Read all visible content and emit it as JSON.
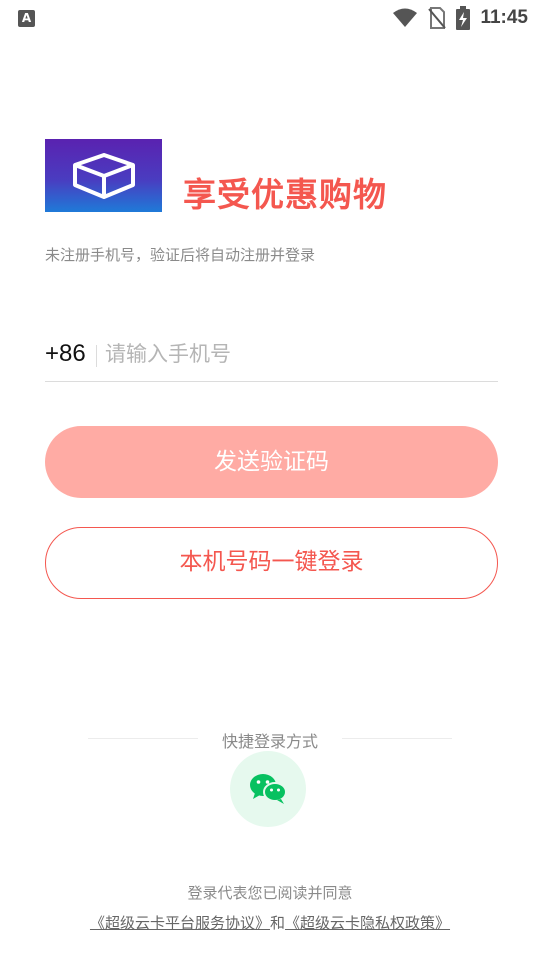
{
  "status_bar": {
    "app_icon_glyph": "A",
    "time": "11:45",
    "icons": [
      "wifi-icon",
      "no-sim-icon",
      "battery-charging-icon"
    ]
  },
  "header": {
    "logo_icon": "box-icon",
    "title": "享受优惠购物",
    "subtitle": "未注册手机号，验证后将自动注册并登录"
  },
  "phone": {
    "country_code": "+86",
    "placeholder": "请输入手机号",
    "value": ""
  },
  "buttons": {
    "send_code": "发送验证码",
    "one_key_login": "本机号码一键登录"
  },
  "quick_login": {
    "label": "快捷登录方式",
    "wechat_icon": "wechat-icon"
  },
  "agreement": {
    "text": "登录代表您已阅读并同意",
    "service_link": "《超级云卡平台服务协议》",
    "conjunction": "和",
    "privacy_link": "《超级云卡隐私权政策》"
  },
  "colors": {
    "accent": "#f4574f",
    "send_button_bg": "#ffaba4",
    "wechat_green": "#07c160",
    "wechat_bg": "#e6f9ee"
  }
}
